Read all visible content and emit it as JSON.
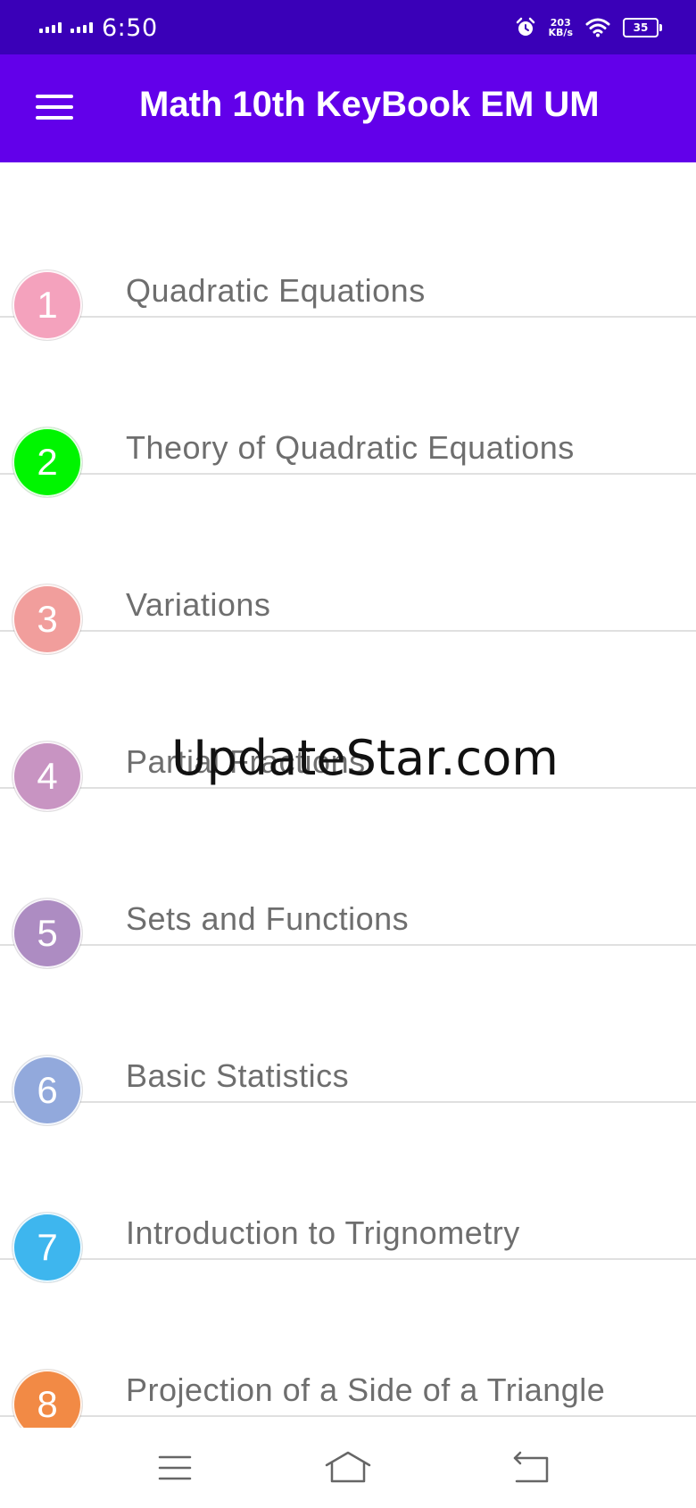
{
  "status_bar": {
    "time": "6:50",
    "speed_value": "203",
    "speed_unit": "KB/s",
    "battery": "35"
  },
  "app_bar": {
    "title": "Math 10th KeyBook EM UM",
    "menu_icon": "hamburger-menu-icon"
  },
  "chapters": [
    {
      "number": "1",
      "title": "Quadratic Equations",
      "color": "#f4a2bd"
    },
    {
      "number": "2",
      "title": "Theory of Quadratic Equations",
      "color": "#00f500"
    },
    {
      "number": "3",
      "title": "Variations",
      "color": "#f19e9c"
    },
    {
      "number": "4",
      "title": "Partial Fractions",
      "color": "#c894c2"
    },
    {
      "number": "5",
      "title": "Sets and Functions",
      "color": "#ad8cc2"
    },
    {
      "number": "6",
      "title": "Basic Statistics",
      "color": "#92a9dc"
    },
    {
      "number": "7",
      "title": "Introduction to Trignometry",
      "color": "#3eb6ee"
    },
    {
      "number": "8",
      "title": "Projection of a Side of a Triangle",
      "color": "#f28a45"
    }
  ],
  "watermark": "UpdateStar.com",
  "colors": {
    "status_bar_bg": "#3a00b8",
    "app_bar_bg": "#6200ea",
    "divider": "#e0e0e0",
    "item_text": "#6e6e6e"
  },
  "nav_bar": {
    "icons": [
      "recents-menu-icon",
      "home-icon",
      "back-icon"
    ]
  }
}
